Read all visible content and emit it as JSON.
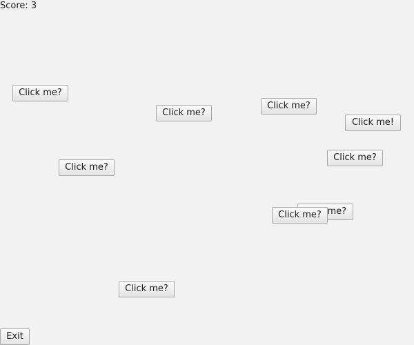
{
  "score_label": "Score: 3",
  "buttons": [
    "Click me?",
    "Click me?",
    "Click me?",
    "Click me!",
    "Click me?",
    "Click me?",
    "me?",
    "Click me?",
    "Click me?"
  ],
  "exit_label": "Exit"
}
